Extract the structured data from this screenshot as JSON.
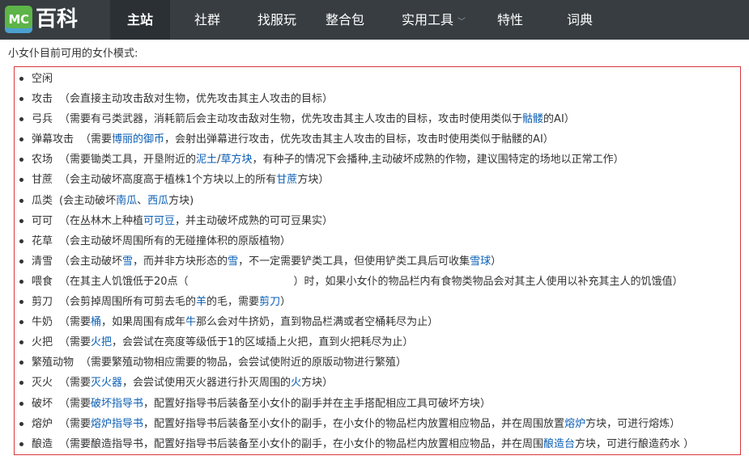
{
  "header": {
    "logo_badge": "MC",
    "logo_text": "百科",
    "nav": [
      {
        "label": "主站",
        "active": true
      },
      {
        "label": "社群"
      },
      {
        "label": "找服玩"
      },
      {
        "label": "整合包"
      },
      {
        "label": "实用工具",
        "has_dropdown": true
      },
      {
        "label": "特性"
      },
      {
        "label": "词典"
      }
    ]
  },
  "intro": "小女仆目前可用的女仆模式:",
  "modes": [
    {
      "name": "空闲",
      "desc": []
    },
    {
      "name": "攻击",
      "desc": [
        {
          "t": "（会直接主动攻击敌对生物，优先攻击其主人攻击的目标）"
        }
      ]
    },
    {
      "name": "弓兵",
      "desc": [
        {
          "t": "（需要有弓类武器，消耗箭后会主动攻击敌对生物，优先攻击其主人攻击的目标，攻击时使用类似于"
        },
        {
          "t": "骷髅",
          "link": true
        },
        {
          "t": "的AI）"
        }
      ]
    },
    {
      "name": "弹幕攻击",
      "desc": [
        {
          "t": "（需要"
        },
        {
          "t": "博丽的御币",
          "link": true
        },
        {
          "t": "，会射出弹幕进行攻击，优先攻击其主人攻击的目标，攻击时使用类似于骷髅的AI）"
        }
      ]
    },
    {
      "name": "农场",
      "desc": [
        {
          "t": "（需要锄类工具，开垦附近的"
        },
        {
          "t": "泥土",
          "link": true
        },
        {
          "t": "/"
        },
        {
          "t": "草方块",
          "link": true
        },
        {
          "t": "，有种子的情况下会播种,主动破坏成熟的作物，建议围特定的场地以正常工作）"
        }
      ]
    },
    {
      "name": "甘蔗",
      "desc": [
        {
          "t": "（会主动破坏高度高于植株1个方块以上的所有"
        },
        {
          "t": "甘蔗",
          "link": true
        },
        {
          "t": "方块）"
        }
      ]
    },
    {
      "name": "瓜类",
      "desc": [
        {
          "t": "(会主动破坏"
        },
        {
          "t": "南瓜",
          "link": true
        },
        {
          "t": "、"
        },
        {
          "t": "西瓜",
          "link": true
        },
        {
          "t": "方块)"
        }
      ]
    },
    {
      "name": "可可",
      "desc": [
        {
          "t": "（在丛林木上种植"
        },
        {
          "t": "可可豆",
          "link": true
        },
        {
          "t": "，并主动破坏成熟的可可豆果实）"
        }
      ]
    },
    {
      "name": "花草",
      "desc": [
        {
          "t": "（会主动破坏周围所有的无碰撞体积的原版植物）"
        }
      ]
    },
    {
      "name": "清雪",
      "desc": [
        {
          "t": "（会主动破坏"
        },
        {
          "t": "雪",
          "link": true
        },
        {
          "t": "，而并非方块形态的"
        },
        {
          "t": "雪",
          "link": true
        },
        {
          "t": "，不一定需要铲类工具，但使用铲类工具后可收集"
        },
        {
          "t": "雪球",
          "link": true
        },
        {
          "t": "）"
        }
      ]
    },
    {
      "name": "喂食",
      "desc": [
        {
          "t": "（在其主人饥饿低于20点（　　　　　　　　　　）时，如果小女仆的物品栏内有食物类物品会对其主人使用以补充其主人的饥饿值）"
        }
      ]
    },
    {
      "name": "剪刀",
      "desc": [
        {
          "t": "（会剪掉周围所有可剪去毛的"
        },
        {
          "t": "羊",
          "link": true
        },
        {
          "t": "的毛，需要"
        },
        {
          "t": "剪刀",
          "link": true
        },
        {
          "t": "）"
        }
      ]
    },
    {
      "name": "牛奶",
      "desc": [
        {
          "t": "（需要"
        },
        {
          "t": "桶",
          "link": true
        },
        {
          "t": "，如果周围有成年"
        },
        {
          "t": "牛",
          "link": true
        },
        {
          "t": "那么会对牛挤奶，直到物品栏满或者空桶耗尽为止）"
        }
      ]
    },
    {
      "name": "火把",
      "desc": [
        {
          "t": "（需要"
        },
        {
          "t": "火把",
          "link": true
        },
        {
          "t": "，会尝试在亮度等级低于1的区域插上火把，直到火把耗尽为止）"
        }
      ]
    },
    {
      "name": "繁殖动物",
      "desc": [
        {
          "t": "（需要繁殖动物相应需要的物品，会尝试使附近的原版动物进行繁殖）"
        }
      ]
    },
    {
      "name": "灭火",
      "desc": [
        {
          "t": "（需要"
        },
        {
          "t": "灭火器",
          "link": true
        },
        {
          "t": "，会尝试使用灭火器进行扑灭周围的"
        },
        {
          "t": "火",
          "link": true
        },
        {
          "t": "方块）"
        }
      ]
    },
    {
      "name": "破坏",
      "desc": [
        {
          "t": "（需要"
        },
        {
          "t": "破坏指导书",
          "link": true
        },
        {
          "t": "，配置好指导书后装备至小女仆的副手并在主手搭配相应工具可破坏方块）"
        }
      ]
    },
    {
      "name": "熔炉",
      "desc": [
        {
          "t": "（需要"
        },
        {
          "t": "熔炉指导书",
          "link": true
        },
        {
          "t": "，配置好指导书后装备至小女仆的副手，在小女仆的物品栏内放置相应物品，并在周围放置"
        },
        {
          "t": "熔炉",
          "link": true
        },
        {
          "t": "方块，可进行熔炼）"
        }
      ]
    },
    {
      "name": "酿造",
      "desc": [
        {
          "t": "（需要酿造指导书，配置好指导书后装备至小女仆的副手，在小女仆的物品栏内放置相应物品，并在周围"
        },
        {
          "t": "酿造台",
          "link": true
        },
        {
          "t": "方块，可进行酿造药水 ）"
        }
      ]
    }
  ],
  "colors": {
    "topbar": "#373d41",
    "link": "#0b5fb5",
    "box_border": "#d9363e"
  }
}
